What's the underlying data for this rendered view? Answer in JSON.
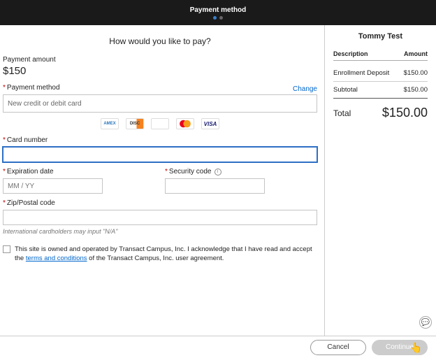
{
  "header": {
    "title": "Payment method"
  },
  "left": {
    "question": "How would you like to pay?",
    "amount_label": "Payment amount",
    "amount_value": "$150",
    "pm_label": "Payment method",
    "change": "Change",
    "pm_value": "New credit or debit card",
    "card_label": "Card number",
    "exp_label": "Expiration date",
    "exp_placeholder": "MM / YY",
    "sec_label": "Security code",
    "zip_label": "Zip/Postal code",
    "hint": "International cardholders may input \"N/A\"",
    "terms_pre": "This site is owned and operated by Transact Campus, Inc. I acknowledge that I have read and accept the ",
    "terms_link": "terms and conditions",
    "terms_post": " of the Transact Campus, Inc. user agreement."
  },
  "right": {
    "name": "Tommy Test",
    "desc_h": "Description",
    "amt_h": "Amount",
    "line_desc": "Enrollment Deposit",
    "line_amt": "$150.00",
    "sub_label": "Subtotal",
    "sub_amt": "$150.00",
    "total_label": "Total",
    "total_amt": "$150.00"
  },
  "footer": {
    "cancel": "Cancel",
    "continue": "Continue"
  }
}
